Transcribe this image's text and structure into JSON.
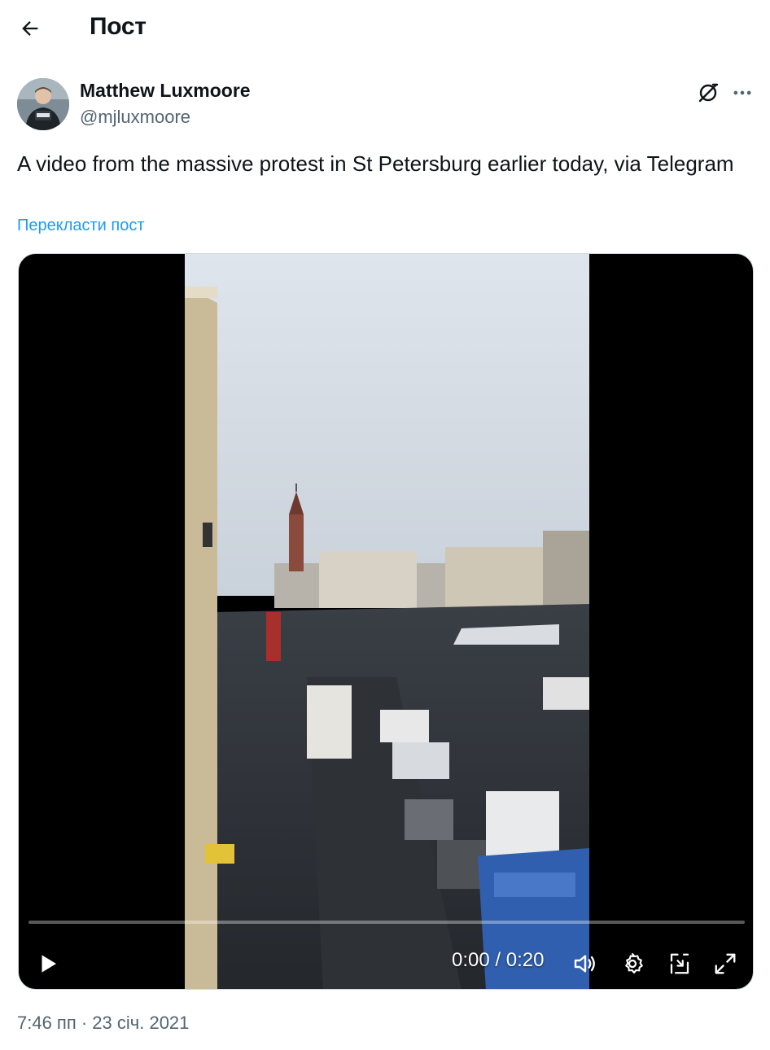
{
  "header": {
    "title": "Пост",
    "back_icon": "arrow-left-icon"
  },
  "author": {
    "name": "Matthew Luxmoore",
    "handle": "@mjluxmoore",
    "avatar_badge": "PRESS"
  },
  "post": {
    "text": "A video from the massive protest in St Petersburg earlier today, via Telegram",
    "translate_label": "Перекласти пост"
  },
  "video": {
    "time_display": "0:00 / 0:20",
    "progress": 0.0,
    "controls": [
      "play-icon",
      "volume-icon",
      "settings-gear-icon",
      "picture-in-picture-icon",
      "fullscreen-icon"
    ]
  },
  "meta": {
    "timestamp": "7:46 пп · 23 січ. 2021"
  },
  "colors": {
    "accent": "#1d9bf0",
    "text_primary": "#0f1419",
    "text_secondary": "#536471"
  }
}
